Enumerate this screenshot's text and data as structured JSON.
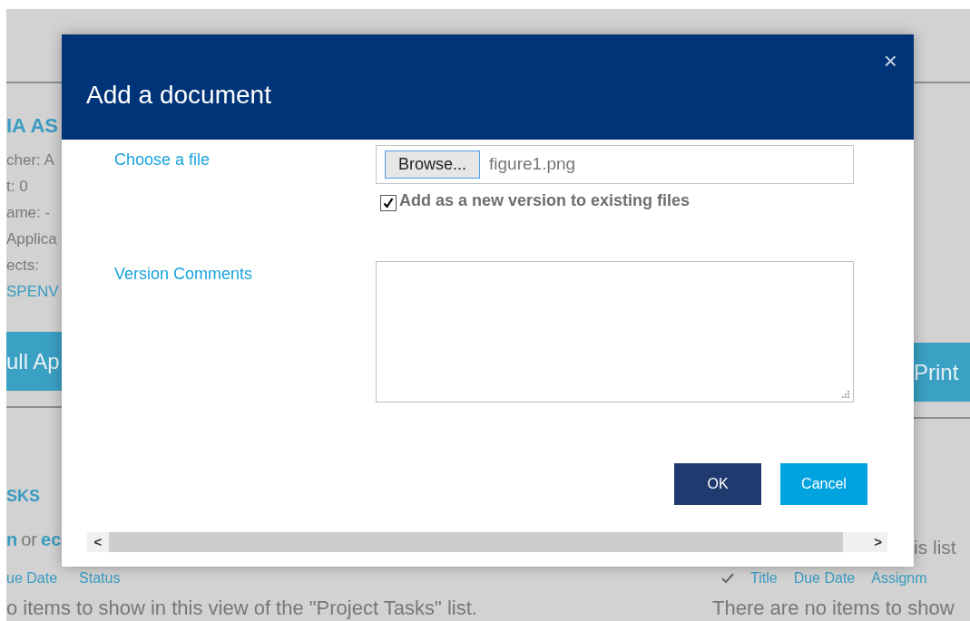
{
  "background": {
    "left": {
      "heading": "IA AS",
      "fields": [
        "cher: A",
        "t: 0",
        "ame: -",
        "Applica",
        "ects:"
      ],
      "link": "SPENV",
      "button": "ull Ap",
      "section_title": "SKS",
      "actions": [
        {
          "text": "n",
          "kind": "link"
        },
        {
          "text": "or",
          "kind": "plain"
        },
        {
          "text": "ec",
          "kind": "link"
        }
      ],
      "columns": [
        "ue Date",
        "Status"
      ],
      "message": "o items to show in this view of the \"Project Tasks\" list."
    },
    "right": {
      "button": "Print",
      "actions_text": "is list",
      "columns": [
        "Title",
        "Due Date",
        "Assignm"
      ],
      "message": "There are no items to show"
    }
  },
  "dialog": {
    "title": "Add a document",
    "close": "×",
    "file": {
      "label": "Choose a file",
      "browse": "Browse...",
      "value": "figure1.png"
    },
    "version_checkbox": {
      "label": "Add as a new version to existing files",
      "checked": true
    },
    "comments": {
      "label": "Version Comments"
    },
    "buttons": [
      {
        "label": "OK",
        "kind": "primary"
      },
      {
        "label": "Cancel",
        "kind": "secondary"
      }
    ],
    "scroll_left": "<",
    "scroll_right": ">"
  }
}
